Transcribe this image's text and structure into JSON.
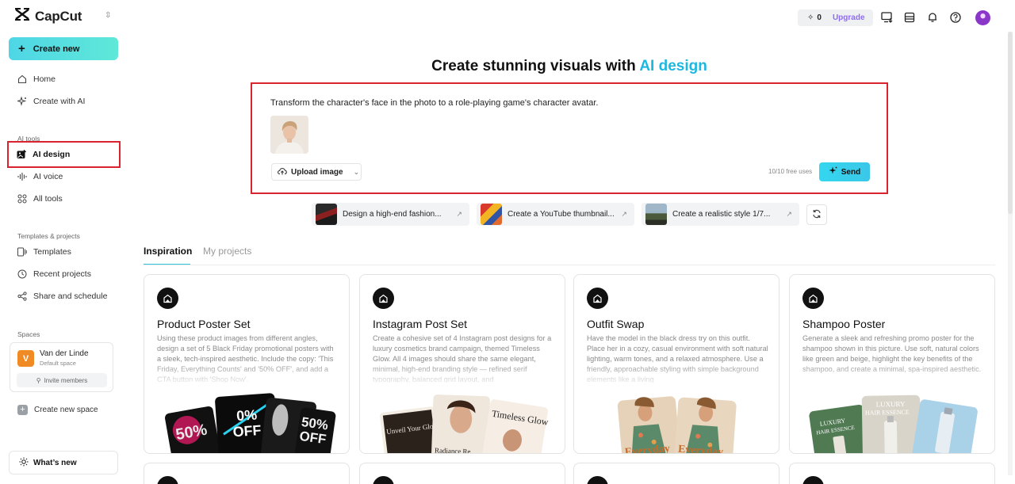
{
  "app": {
    "name": "CapCut"
  },
  "sidebar": {
    "create_new": "Create new",
    "nav": [
      {
        "label": "Home",
        "icon": "home-icon"
      },
      {
        "label": "Create with AI",
        "icon": "sparkle-icon"
      }
    ],
    "ai_tools_label": "AI tools",
    "ai_tools": [
      {
        "label": "AI design",
        "icon": "image-edit-icon",
        "active": true
      },
      {
        "label": "AI voice",
        "icon": "waveform-icon"
      },
      {
        "label": "All tools",
        "icon": "grid-icon"
      }
    ],
    "templates_label": "Templates & projects",
    "templates": [
      {
        "label": "Templates",
        "icon": "template-icon"
      },
      {
        "label": "Recent projects",
        "icon": "clock-icon"
      },
      {
        "label": "Share and schedule",
        "icon": "share-icon"
      }
    ],
    "spaces_label": "Spaces",
    "space": {
      "initial": "V",
      "name": "Van der Linde",
      "sub": "Default space",
      "invite": "Invite members"
    },
    "new_space": "Create new space",
    "whats_new": "What’s new"
  },
  "topbar": {
    "credits": "0",
    "upgrade": "Upgrade"
  },
  "hero": {
    "title_prefix": "Create stunning visuals with ",
    "title_highlight": "AI design",
    "prompt": "Transform the character's face in the photo to a role-playing game's character avatar.",
    "upload": "Upload image",
    "free_uses": "10/10 free uses",
    "send": "Send"
  },
  "suggestions": [
    "Design a high-end fashion...",
    "Create a YouTube thumbnail...",
    "Create a realistic style 1/7..."
  ],
  "tabs": {
    "inspiration": "Inspiration",
    "projects": "My projects"
  },
  "cards": [
    {
      "title": "Product Poster Set",
      "desc": "Using these product images from different angles, design a set of 5 Black Friday promotional posters with a sleek, tech-inspired aesthetic. Include the copy: 'This Friday, Everything Counts' and '50% OFF', and add a CTA button with 'Shop Now'."
    },
    {
      "title": "Instagram Post Set",
      "desc": "Create a cohesive set of 4 Instagram post designs for a luxury cosmetics brand campaign, themed Timeless Glow. All 4 images should share the same elegant, minimal, high-end branding style — refined serif typography, balanced grid layout, and"
    },
    {
      "title": "Outfit Swap",
      "desc": "Have the model in the black dress try on this outfit. Place her in a cozy, casual environment with soft natural lighting, warm tones, and a relaxed atmosphere. Use a friendly, approachable styling with simple background elements like a living"
    },
    {
      "title": "Shampoo Poster",
      "desc": "Generate a sleek and refreshing promo poster for the shampoo shown in this picture. Use soft, natural colors like green and beige, highlight the key benefits of the shampoo, and create a minimal, spa-inspired aesthetic."
    }
  ],
  "card_art": {
    "poster_a": "50%",
    "poster_b": "0%",
    "poster_c": "OFF",
    "poster_d": "50%",
    "poster_e": "OFF",
    "insta_a": "Unveil Your Glow",
    "insta_b": "Timeless Glow",
    "insta_c": "Radiance Re",
    "outfit_a": "Everyday",
    "outfit_b": "Everyday",
    "shampoo_a": "LUXURY",
    "shampoo_b": "HAIR ESSENCE",
    "shampoo_c": "LUXURY",
    "shampoo_d": "HAIR ESSENCE"
  },
  "colors": {
    "accent": "#2fc3dc",
    "highlight_border": "#d9232e",
    "upgrade": "#8f6cf2"
  }
}
